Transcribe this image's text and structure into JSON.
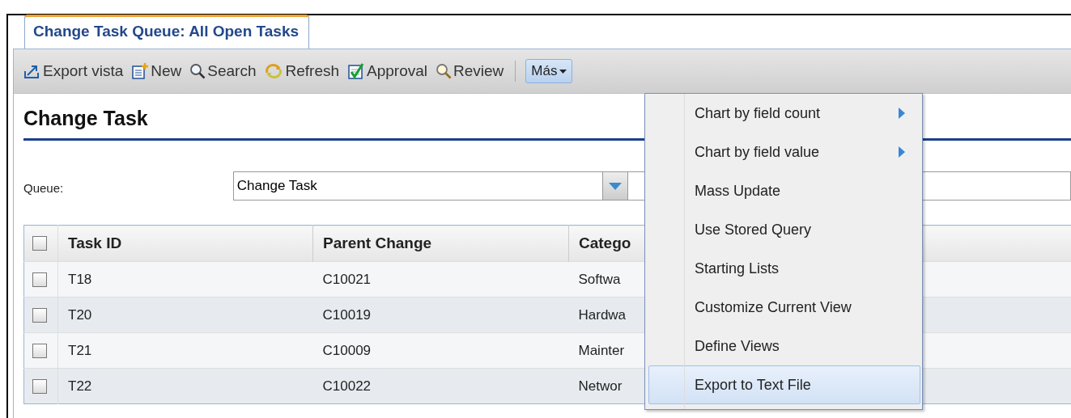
{
  "tab": {
    "title": "Change Task Queue: All Open Tasks",
    "selected": true
  },
  "toolbar": [
    {
      "kind": "export",
      "label": "Export vista"
    },
    {
      "kind": "new",
      "label": "New"
    },
    {
      "kind": "search",
      "label": "Search"
    },
    {
      "kind": "refresh",
      "label": "Refresh"
    },
    {
      "kind": "approval",
      "label": "Approval"
    },
    {
      "kind": "review",
      "label": "Review"
    }
  ],
  "more_button": {
    "label": "Más",
    "selected": true
  },
  "heading": "Change Task",
  "queue": {
    "label": "Queue:",
    "value": "Change Task"
  },
  "table": {
    "select_all": {
      "checked": false
    },
    "columns": [
      "Task ID",
      "Parent Change",
      "Catego"
    ],
    "rows": [
      {
        "checked": false,
        "cells": [
          "T18",
          "C10021",
          "Softwa"
        ]
      },
      {
        "checked": false,
        "cells": [
          "T20",
          "C10019",
          "Hardwa"
        ]
      },
      {
        "checked": false,
        "cells": [
          "T21",
          "C10009",
          "Mainter"
        ]
      },
      {
        "checked": false,
        "cells": [
          "T22",
          "C10022",
          "Networ"
        ]
      }
    ]
  },
  "menu": [
    {
      "label": "Chart by field count",
      "submenu": true,
      "selected": false
    },
    {
      "label": "Chart by field value",
      "submenu": true,
      "selected": false
    },
    {
      "label": "Mass Update",
      "submenu": false,
      "selected": false
    },
    {
      "label": "Use Stored Query",
      "submenu": false,
      "selected": false
    },
    {
      "label": "Starting Lists",
      "submenu": false,
      "selected": false
    },
    {
      "label": "Customize Current View",
      "submenu": false,
      "selected": false
    },
    {
      "label": "Define Views",
      "submenu": false,
      "selected": false
    },
    {
      "label": "Export to Text File",
      "submenu": false,
      "selected": true
    }
  ]
}
